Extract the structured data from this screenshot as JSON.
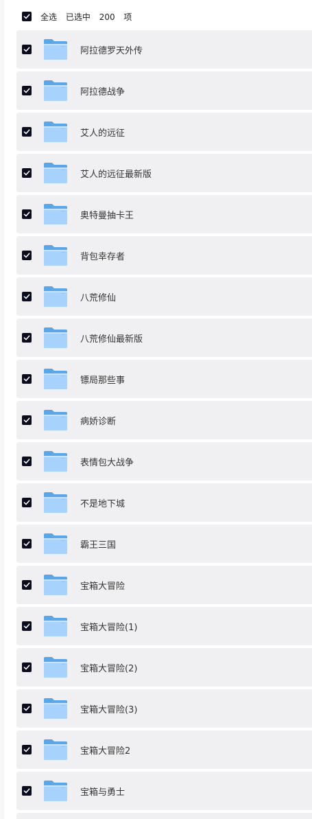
{
  "header": {
    "select_all_label": "全选",
    "selected_prefix": "已选中",
    "selected_count": "200",
    "selected_suffix": "项"
  },
  "colors": {
    "checkbox": "#0b0b1f",
    "row_bg": "#f0f0f2",
    "folder_back": "#5aa6e6",
    "folder_front": "#a6d2fb"
  },
  "icons": {
    "checkbox": "checkmark-icon",
    "item": "folder-icon"
  },
  "items": [
    {
      "name": "阿拉德罗天外传",
      "checked": true
    },
    {
      "name": "阿拉德战争",
      "checked": true
    },
    {
      "name": "艾人的远征",
      "checked": true
    },
    {
      "name": "艾人的远征最新版",
      "checked": true
    },
    {
      "name": "奥特曼抽卡王",
      "checked": true
    },
    {
      "name": "背包幸存者",
      "checked": true
    },
    {
      "name": "八荒修仙",
      "checked": true
    },
    {
      "name": "八荒修仙最新版",
      "checked": true
    },
    {
      "name": "镖局那些事",
      "checked": true
    },
    {
      "name": "病娇诊断",
      "checked": true
    },
    {
      "name": "表情包大战争",
      "checked": true
    },
    {
      "name": "不是地下城",
      "checked": true
    },
    {
      "name": "霸王三国",
      "checked": true
    },
    {
      "name": "宝箱大冒险",
      "checked": true
    },
    {
      "name": "宝箱大冒险(1)",
      "checked": true
    },
    {
      "name": "宝箱大冒险(2)",
      "checked": true
    },
    {
      "name": "宝箱大冒险(3)",
      "checked": true
    },
    {
      "name": "宝箱大冒险2",
      "checked": true
    },
    {
      "name": "宝箱与勇士",
      "checked": true
    }
  ]
}
